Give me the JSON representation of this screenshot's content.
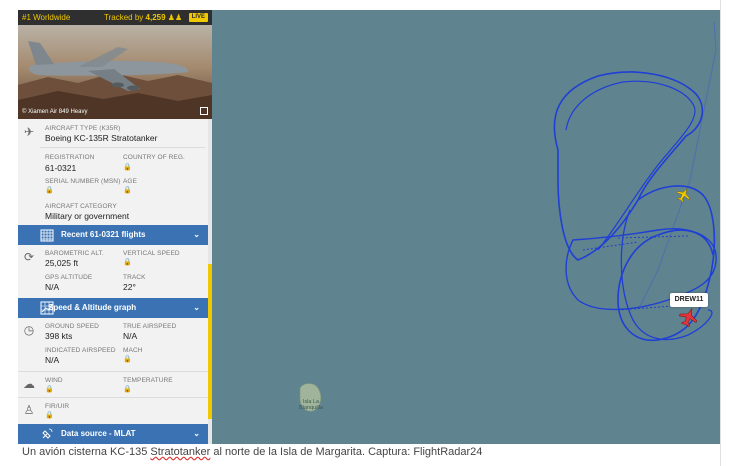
{
  "topbar": {
    "rank": "#1 Worldwide",
    "tracked_label": "Tracked by",
    "tracked_count": "4,259",
    "live": "LIVE"
  },
  "photo": {
    "credit": "© Xiamen Air 849 Heavy"
  },
  "aircraft": {
    "type_label": "AIRCRAFT TYPE (K35R)",
    "type_value": "Boeing KC-135R Stratotanker",
    "registration_label": "REGISTRATION",
    "registration_value": "61-0321",
    "country_label": "COUNTRY OF REG.",
    "serial_label": "SERIAL NUMBER (MSN)",
    "age_label": "AGE",
    "category_label": "AIRCRAFT CATEGORY",
    "category_value": "Military or government"
  },
  "recent_bar": "Recent 61-0321 flights",
  "altitude": {
    "baro_label": "BAROMETRIC ALT.",
    "baro_value": "25,025 ft",
    "vspeed_label": "VERTICAL SPEED",
    "gps_label": "GPS ALTITUDE",
    "gps_value": "N/A",
    "track_label": "TRACK",
    "track_value": "22°"
  },
  "speed_bar": "Speed & Altitude graph",
  "speed": {
    "ground_label": "GROUND SPEED",
    "ground_value": "398 kts",
    "true_label": "TRUE AIRSPEED",
    "true_value": "N/A",
    "indicated_label": "INDICATED AIRSPEED",
    "indicated_value": "N/A",
    "mach_label": "MACH"
  },
  "weather": {
    "wind_label": "WIND",
    "temp_label": "TEMPERATURE"
  },
  "fir": {
    "fir_label": "FIR/UIR"
  },
  "source_bar": "Data source - MLAT",
  "map": {
    "callsign": "DREW11",
    "island_name": "Isla La Blanquilla",
    "track_color": "#1f3fd6",
    "sea_color": "#5f838f"
  },
  "caption": {
    "before": "Un avión cisterna KC-135 ",
    "underlined": "Stratotanker",
    "after": " al norte de la Isla de Margarita. Captura: FlightRadar24"
  }
}
